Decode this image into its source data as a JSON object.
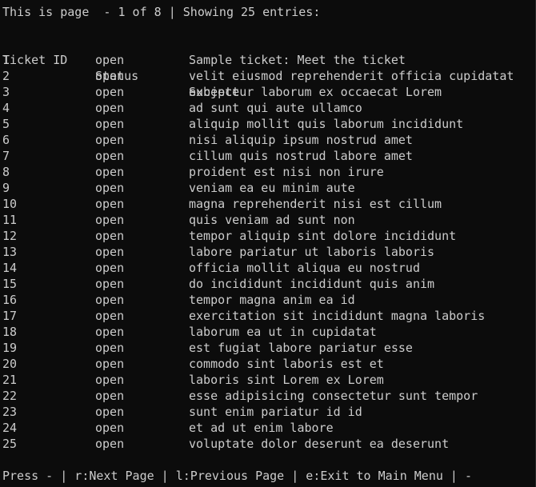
{
  "header": {
    "page_info": "This is page  - 1 of 8 | Showing 25 entries:"
  },
  "table": {
    "columns": [
      "Ticket ID",
      "Status",
      "Subject"
    ],
    "rows": [
      {
        "id": "1",
        "status": "open",
        "subject": "Sample ticket: Meet the ticket"
      },
      {
        "id": "2",
        "status": "open",
        "subject": "velit eiusmod reprehenderit officia cupidatat"
      },
      {
        "id": "3",
        "status": "open",
        "subject": "excepteur laborum ex occaecat Lorem"
      },
      {
        "id": "4",
        "status": "open",
        "subject": "ad sunt qui aute ullamco"
      },
      {
        "id": "5",
        "status": "open",
        "subject": "aliquip mollit quis laborum incididunt"
      },
      {
        "id": "6",
        "status": "open",
        "subject": "nisi aliquip ipsum nostrud amet"
      },
      {
        "id": "7",
        "status": "open",
        "subject": "cillum quis nostrud labore amet"
      },
      {
        "id": "8",
        "status": "open",
        "subject": "proident est nisi non irure"
      },
      {
        "id": "9",
        "status": "open",
        "subject": "veniam ea eu minim aute"
      },
      {
        "id": "10",
        "status": "open",
        "subject": "magna reprehenderit nisi est cillum"
      },
      {
        "id": "11",
        "status": "open",
        "subject": "quis veniam ad sunt non"
      },
      {
        "id": "12",
        "status": "open",
        "subject": "tempor aliquip sint dolore incididunt"
      },
      {
        "id": "13",
        "status": "open",
        "subject": "labore pariatur ut laboris laboris"
      },
      {
        "id": "14",
        "status": "open",
        "subject": "officia mollit aliqua eu nostrud"
      },
      {
        "id": "15",
        "status": "open",
        "subject": "do incididunt incididunt quis anim"
      },
      {
        "id": "16",
        "status": "open",
        "subject": "tempor magna anim ea id"
      },
      {
        "id": "17",
        "status": "open",
        "subject": "exercitation sit incididunt magna laboris"
      },
      {
        "id": "18",
        "status": "open",
        "subject": "laborum ea ut in cupidatat"
      },
      {
        "id": "19",
        "status": "open",
        "subject": "est fugiat labore pariatur esse"
      },
      {
        "id": "20",
        "status": "open",
        "subject": "commodo sint laboris est et"
      },
      {
        "id": "21",
        "status": "open",
        "subject": "laboris sint Lorem ex Lorem"
      },
      {
        "id": "22",
        "status": "open",
        "subject": "esse adipisicing consectetur sunt tempor"
      },
      {
        "id": "23",
        "status": "open",
        "subject": "sunt enim pariatur id id"
      },
      {
        "id": "24",
        "status": "open",
        "subject": "et ad ut enim labore"
      },
      {
        "id": "25",
        "status": "open",
        "subject": "voluptate dolor deserunt ea deserunt"
      }
    ]
  },
  "footer": {
    "prompt": "Press - | r:Next Page | l:Previous Page | e:Exit to Main Menu | -"
  },
  "colors": {
    "background": "#0c0c0c",
    "text": "#cccccc"
  }
}
